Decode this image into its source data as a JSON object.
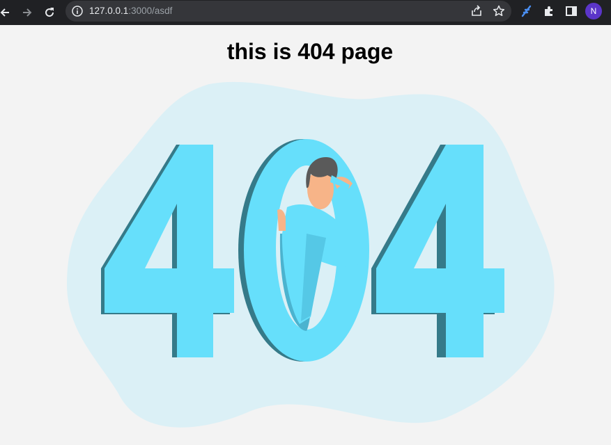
{
  "browser": {
    "url_host": "127.0.0.1",
    "url_path": ":3000/asdf",
    "profile_initial": "N",
    "icons": [
      "back-icon",
      "forward-icon",
      "reload-icon",
      "info-icon",
      "share-icon",
      "bookmark-star-icon",
      "extension-feather-icon",
      "puzzle-icon",
      "sidepanel-icon"
    ]
  },
  "page": {
    "heading": "this is 404 page"
  },
  "illustration": {
    "text": "404",
    "colors": {
      "blob": "#dbf0f6",
      "digit_face": "#66dffb",
      "digit_side": "#357a89",
      "skin": "#f7b488",
      "hair": "#5a5a5a"
    }
  }
}
